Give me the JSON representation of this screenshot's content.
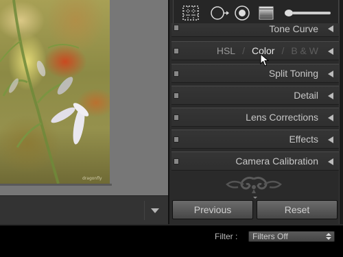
{
  "photo": {
    "watermark": "dragonfly"
  },
  "tools": [
    {
      "name": "crop-overlay-icon"
    },
    {
      "name": "spot-removal-icon"
    },
    {
      "name": "red-eye-icon"
    },
    {
      "name": "graduated-filter-icon"
    },
    {
      "name": "adjustment-brush-icon"
    }
  ],
  "panels": {
    "tone_curve": "Tone Curve",
    "hsl": {
      "hsl": "HSL",
      "sep1": "/",
      "color": "Color",
      "sep2": "/",
      "bw": "B & W"
    },
    "split_toning": "Split Toning",
    "detail": "Detail",
    "lens_corrections": "Lens Corrections",
    "effects": "Effects",
    "camera_calibration": "Camera Calibration"
  },
  "buttons": {
    "previous": "Previous",
    "reset": "Reset"
  },
  "filter": {
    "label": "Filter :",
    "value": "Filters Off"
  }
}
